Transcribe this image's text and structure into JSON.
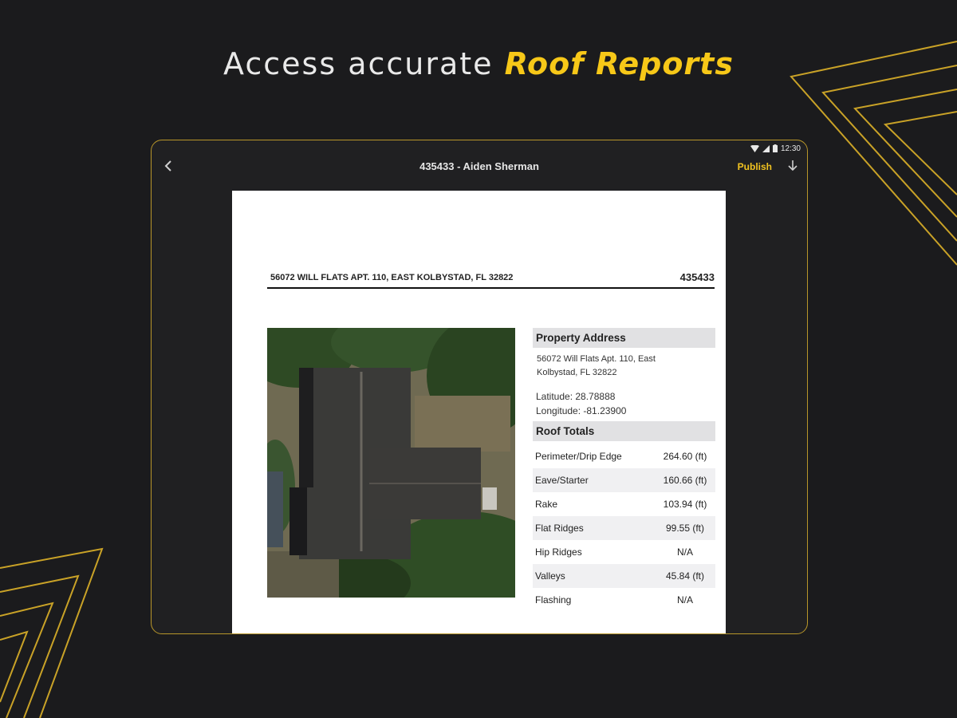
{
  "headline": {
    "prefix": "Access accurate",
    "accent": "Roof Reports"
  },
  "status_bar": {
    "time": "12:30"
  },
  "app_bar": {
    "title": "435433 - Aiden Sherman",
    "publish_label": "Publish"
  },
  "report": {
    "address_line": "56072 WILL FLATS APT. 110, EAST KOLBYSTAD, FL 32822",
    "report_number": "435433",
    "property_address": {
      "heading": "Property Address",
      "address_line1": "56072 Will Flats Apt. 110, East",
      "address_line2": "Kolbystad, FL 32822",
      "latitude": "Latitude: 28.78888",
      "longitude": "Longitude: -81.23900"
    },
    "roof_totals": {
      "heading": "Roof Totals",
      "rows": [
        {
          "label": "Perimeter/Drip Edge",
          "value": "264.60 (ft)"
        },
        {
          "label": "Eave/Starter",
          "value": "160.66 (ft)"
        },
        {
          "label": "Rake",
          "value": "103.94 (ft)"
        },
        {
          "label": "Flat Ridges",
          "value": "99.55 (ft)"
        },
        {
          "label": "Hip Ridges",
          "value": "N/A"
        },
        {
          "label": "Valleys",
          "value": "45.84 (ft)"
        },
        {
          "label": "Flashing",
          "value": "N/A"
        }
      ]
    }
  },
  "colors": {
    "accent": "#f7c818",
    "background": "#1b1b1d",
    "device_border": "#b8962a"
  },
  "icons": [
    "back-arrow-icon",
    "download-icon",
    "wifi-icon",
    "signal-icon",
    "battery-icon"
  ]
}
